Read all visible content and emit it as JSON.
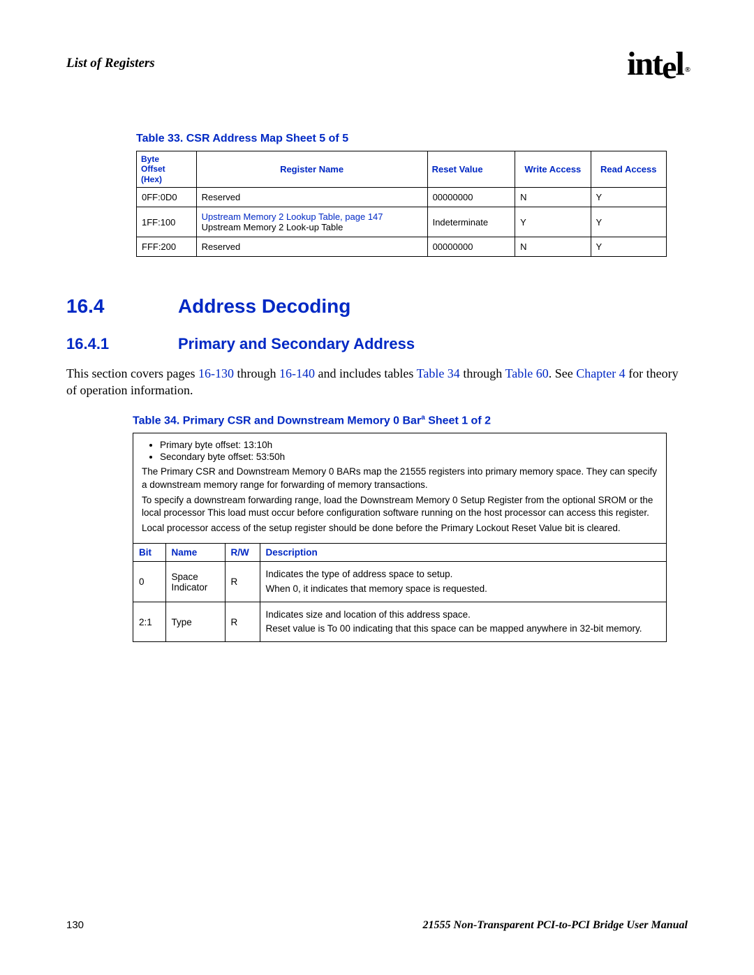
{
  "header": {
    "section_title": "List of Registers",
    "logo_text": "int",
    "logo_e": "e",
    "logo_l": "l",
    "logo_mark": "®"
  },
  "table33": {
    "title": "Table 33.  CSR Address Map  Sheet 5 of 5",
    "headers": {
      "offset": "Byte\nOffset\n(Hex)",
      "name": "Register Name",
      "reset": "Reset Value",
      "wa": "Write Access",
      "ra": "Read Access"
    },
    "rows": [
      {
        "offset": "0FF:0D0",
        "name_plain": "Reserved",
        "name_link": "",
        "name_sub": "",
        "reset": "00000000",
        "wa": "N",
        "ra": "Y"
      },
      {
        "offset": "1FF:100",
        "name_plain": "",
        "name_link": "Upstream Memory 2 Lookup Table, page 147",
        "name_sub": "Upstream Memory 2 Look-up Table",
        "reset": "Indeterminate",
        "wa": "Y",
        "ra": "Y"
      },
      {
        "offset": "FFF:200",
        "name_plain": "Reserved",
        "name_link": "",
        "name_sub": "",
        "reset": "00000000",
        "wa": "N",
        "ra": "Y"
      }
    ]
  },
  "section_16_4": {
    "num": "16.4",
    "title": "Address Decoding"
  },
  "section_16_4_1": {
    "num": "16.4.1",
    "title": "Primary and Secondary Address"
  },
  "intro": {
    "t1": "This section covers pages ",
    "l1": " 16-130",
    "t2": " through ",
    "l2": " 16-140",
    "t3": " and includes tables ",
    "l3": "Table 34",
    "t4": " through ",
    "l4": "Table 60",
    "t5": ". See ",
    "l5": "Chapter 4",
    "t6": " for theory of operation information."
  },
  "table34": {
    "title_pre": "Table 34.  Primary CSR and Downstream Memory 0 Bar",
    "title_sup": "a",
    "title_post": "  Sheet 1 of 2",
    "bullets": [
      "Primary byte offset: 13:10h",
      "Secondary byte offset: 53:50h"
    ],
    "p1": "The Primary CSR and Downstream Memory 0 BARs map the 21555 registers into primary memory space. They can specify a downstream memory range for forwarding of memory transactions.",
    "p2": "To specify a downstream forwarding range, load the Downstream Memory 0 Setup Register from the optional SROM or the local processor This load must occur before configuration software running on the host processor can access this register.",
    "p3": "Local processor access of the setup register should be done before the Primary Lockout Reset Value bit is cleared.",
    "headers": {
      "bit": "Bit",
      "name": "Name",
      "rw": "R/W",
      "desc": "Description"
    },
    "rows": [
      {
        "bit": "0",
        "name": "Space Indicator",
        "rw": "R",
        "d1": "Indicates the type of address space to setup.",
        "d2": "When 0, it indicates that memory space is requested."
      },
      {
        "bit": "2:1",
        "name": "Type",
        "rw": "R",
        "d1": "Indicates size and location of this address space.",
        "d2": "Reset value is To 00 indicating that this space can be mapped anywhere in 32-bit memory."
      }
    ]
  },
  "footer": {
    "page": "130",
    "manual": "21555 Non-Transparent PCI-to-PCI Bridge User Manual"
  }
}
